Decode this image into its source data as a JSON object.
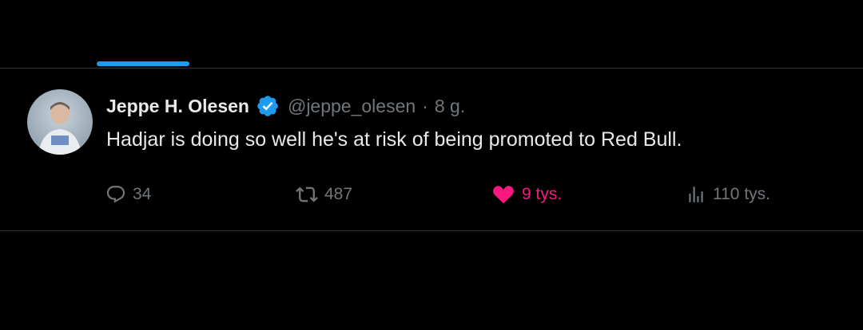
{
  "tweet": {
    "author": {
      "name": "Jeppe H. Olesen",
      "handle": "@jeppe_olesen",
      "verified": true
    },
    "separator": "·",
    "time": "8 g.",
    "text": "Hadjar is doing so well he's at risk of being promoted to Red Bull.",
    "stats": {
      "replies": "34",
      "retweets": "487",
      "likes": "9 tys.",
      "views": "110 tys."
    },
    "liked": true
  },
  "icons": {
    "reply": "speech-bubble-icon",
    "retweet": "retweet-arrows-icon",
    "like": "heart-icon",
    "views": "bar-chart-icon",
    "verified": "verified-badge-icon"
  },
  "colors": {
    "background": "#000000",
    "text_primary": "#e7e9ea",
    "text_secondary": "#71767b",
    "accent": "#1d9bf0",
    "like": "#f91880",
    "divider": "#2f3336"
  }
}
